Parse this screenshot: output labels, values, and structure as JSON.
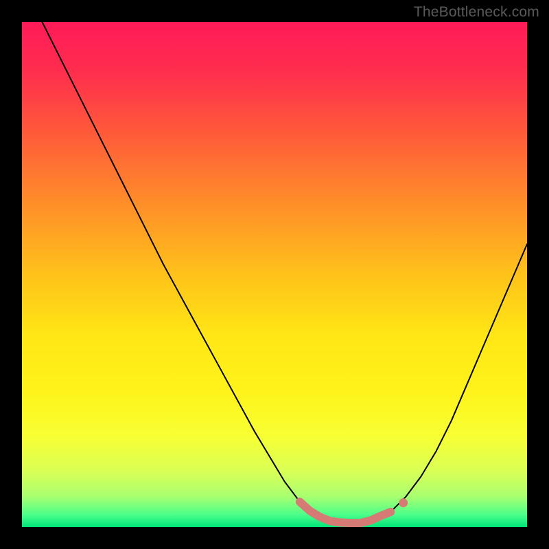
{
  "watermark": "TheBottleneck.com",
  "chart_data": {
    "type": "line",
    "title": "",
    "xlabel": "",
    "ylabel": "",
    "xlim": [
      0,
      100
    ],
    "ylim": [
      0,
      100
    ],
    "gradient_stops": [
      {
        "offset": 0.0,
        "color": "#ff1a58"
      },
      {
        "offset": 0.1,
        "color": "#ff2e4d"
      },
      {
        "offset": 0.22,
        "color": "#ff5a3a"
      },
      {
        "offset": 0.35,
        "color": "#ff8a2a"
      },
      {
        "offset": 0.5,
        "color": "#ffc21a"
      },
      {
        "offset": 0.62,
        "color": "#ffe615"
      },
      {
        "offset": 0.73,
        "color": "#fff31a"
      },
      {
        "offset": 0.82,
        "color": "#f7ff33"
      },
      {
        "offset": 0.89,
        "color": "#d9ff56"
      },
      {
        "offset": 0.94,
        "color": "#a8ff70"
      },
      {
        "offset": 0.975,
        "color": "#4dff8a"
      },
      {
        "offset": 1.0,
        "color": "#00e67a"
      }
    ],
    "series": [
      {
        "name": "bottleneck-curve",
        "color": "#000000",
        "stroke_width": 2.0,
        "x": [
          4,
          10,
          16,
          22,
          28,
          34,
          40,
          46,
          52,
          55,
          58,
          61,
          64,
          67,
          70,
          73,
          76,
          79,
          82,
          85,
          88,
          91,
          94,
          97,
          100
        ],
        "y": [
          100,
          88,
          76,
          64,
          52,
          41,
          30,
          19,
          9,
          5,
          2.5,
          1.2,
          0.8,
          0.8,
          1.3,
          3,
          6,
          10,
          15,
          21,
          28,
          35,
          42,
          49,
          56
        ]
      }
    ],
    "highlight": {
      "color": "#d57a74",
      "dot_radius": 6.5,
      "stroke_width": 12,
      "x": [
        55,
        57,
        59,
        61,
        63,
        65,
        67,
        69,
        71,
        73
      ],
      "y": [
        5.0,
        3.2,
        2.0,
        1.2,
        0.9,
        0.8,
        0.8,
        1.3,
        2.2,
        3.0
      ],
      "end_dot": {
        "x": 75.5,
        "y": 4.8
      }
    }
  }
}
